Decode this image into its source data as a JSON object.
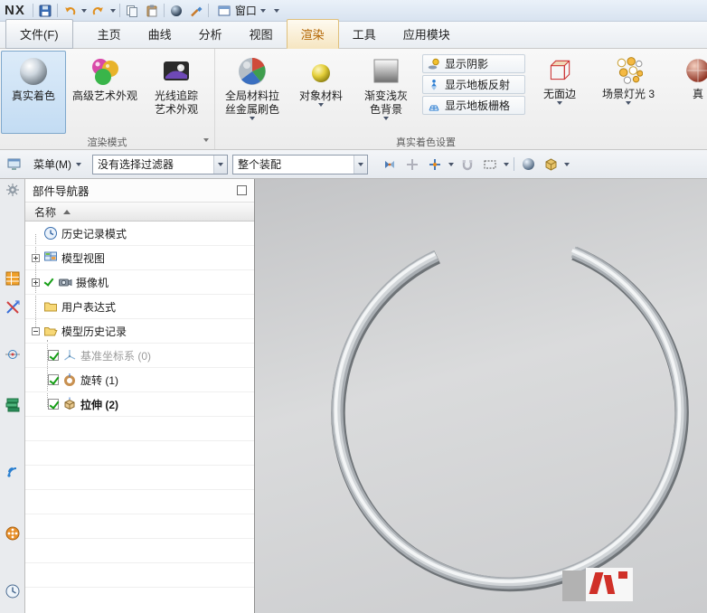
{
  "titlebar": {
    "logo": "NX",
    "window_label": "窗口"
  },
  "tabs": {
    "file": "文件(F)",
    "home": "主页",
    "curve": "曲线",
    "analysis": "分析",
    "view": "视图",
    "render": "渲染",
    "tools": "工具",
    "modules": "应用模块"
  },
  "ribbon": {
    "render_mode": {
      "label": "渲染模式",
      "true_shading": "真实着色",
      "advanced_art": "高级艺术外观",
      "ray_trace_1": "光线追踪",
      "ray_trace_2": "艺术外观"
    },
    "shading_settings": {
      "label": "真实着色设置",
      "global_material_1": "全局材料拉",
      "global_material_2": "丝金属刷色",
      "object_material": "对象材料",
      "gradient_bg_1": "渐变浅灰",
      "gradient_bg_2": "色背景",
      "show_shadow": "显示阴影",
      "show_floor_reflection": "显示地板反射",
      "show_floor_grid": "显示地板栅格",
      "no_face_edge": "无面边",
      "scene_lights": "场景灯光 3",
      "clipped": "真"
    }
  },
  "toolbar": {
    "menu": "菜单(M)",
    "selection_filter": "没有选择过滤器",
    "selection_scope": "整个装配"
  },
  "navigator": {
    "title": "部件导航器",
    "column": "名称",
    "items": [
      {
        "label": "历史记录模式"
      },
      {
        "label": "模型视图"
      },
      {
        "label": "摄像机"
      },
      {
        "label": "用户表达式"
      },
      {
        "label": "模型历史记录"
      },
      {
        "label": "基准坐标系 (0)"
      },
      {
        "label": "旋转 (1)"
      },
      {
        "label": "拉伸 (2)"
      }
    ]
  }
}
